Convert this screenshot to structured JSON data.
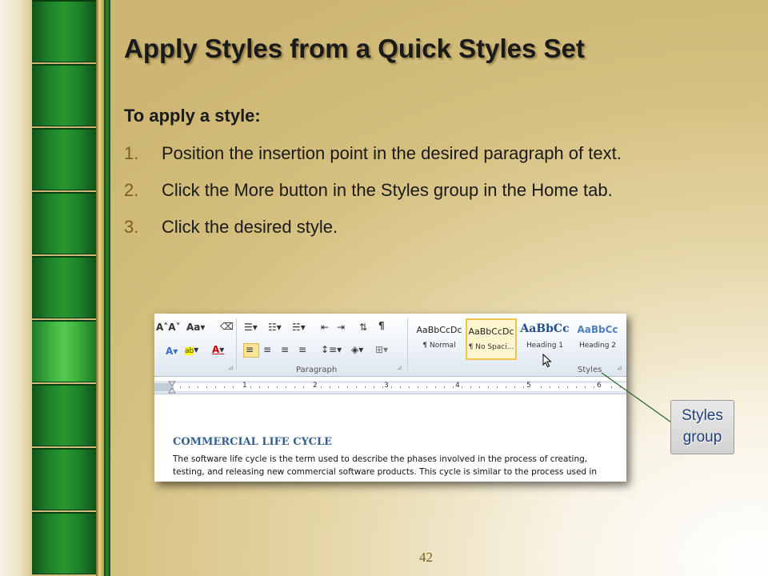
{
  "slide": {
    "title": "Apply Styles from a Quick Styles Set",
    "intro": "To apply a style:",
    "steps": [
      {
        "num": "1.",
        "text": "Position the insertion point in the desired paragraph of text."
      },
      {
        "num": "2.",
        "text": "Click the More button in the Styles group in the Home tab."
      },
      {
        "num": "3.",
        "text": "Click the desired style."
      }
    ],
    "page_number": "42",
    "callout": {
      "line1": "Styles",
      "line2": "group"
    }
  },
  "screenshot": {
    "font_size_label": "Aa",
    "paragraph_label": "Paragraph",
    "styles_label": "Styles",
    "quick_styles": [
      {
        "sample": "AaBbCcDc",
        "name": "¶ Normal"
      },
      {
        "sample": "AaBbCcDc",
        "name": "¶ No Spaci..."
      },
      {
        "sample": "AaBbCc",
        "name": "Heading 1"
      },
      {
        "sample": "AaBbCc",
        "name": "Heading 2"
      }
    ],
    "ruler_numbers": [
      "1",
      "2",
      "3",
      "4",
      "5",
      "6"
    ],
    "document": {
      "heading": "COMMERCIAL LIFE CYCLE",
      "lines": [
        "The software life cycle is the term used to describe the phases involved in the process of creating,",
        "testing, and releasing new commercial software products. This cycle is similar to the process used in"
      ]
    }
  },
  "colors": {
    "title": "#1a1a1a",
    "number": "#7b5f17",
    "tile_green": "#1e7f2a",
    "tile_light_green": "#55c84d",
    "callout_text": "#1f3f7a"
  }
}
